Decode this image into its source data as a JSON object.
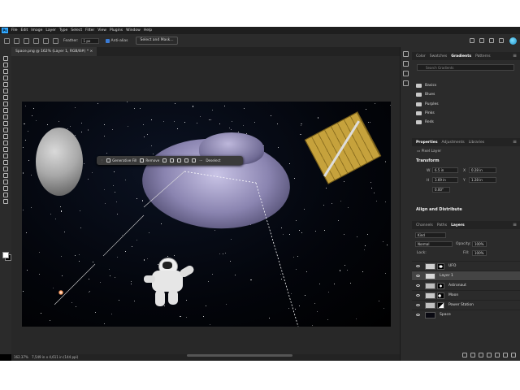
{
  "menubar": {
    "logo": "Ps",
    "items": [
      "File",
      "Edit",
      "Image",
      "Layer",
      "Type",
      "Select",
      "Filter",
      "View",
      "Plugins",
      "Window",
      "Help"
    ]
  },
  "options": {
    "feather_label": "Feather:",
    "feather_value": "1 px",
    "antialias_label": "Anti-alias",
    "select_mask": "Select and Mask..."
  },
  "document": {
    "tab": "Space.png @ 162% (Layer 1, RGB/8#) *"
  },
  "context_bar": {
    "generative_fill": "Generative Fill",
    "remove": "Remove",
    "deselect": "Deselect"
  },
  "status": {
    "zoom": "162.37%",
    "size": "7,549 in x 4,611 in (144 ppi)"
  },
  "gradients_panel": {
    "tabs": [
      "Color",
      "Swatches",
      "Gradients",
      "Patterns"
    ],
    "active": "Gradients",
    "search_placeholder": "Search Gradients",
    "folders": [
      "Basics",
      "Blues",
      "Purples",
      "Pinks",
      "Reds"
    ]
  },
  "properties_panel": {
    "tabs": [
      "Properties",
      "Adjustments",
      "Libraries"
    ],
    "layer_type": "Pixel Layer",
    "transform_title": "Transform",
    "w_label": "W",
    "w_value": "6.5 in",
    "x_label": "X",
    "x_value": "0.28 in",
    "h_label": "H",
    "h_value": "3.69 in",
    "y_label": "Y",
    "y_value": "1.28 in",
    "angle_value": "0.00°",
    "align_title": "Align and Distribute"
  },
  "layers_panel": {
    "tabs": [
      "Channels",
      "Paths",
      "Layers"
    ],
    "kind": "Kind",
    "blend_mode": "Normal",
    "opacity_label": "Opacity:",
    "opacity_value": "100%",
    "lock_label": "Lock:",
    "fill_label": "Fill:",
    "fill_value": "100%",
    "layers": [
      {
        "name": "UFO"
      },
      {
        "name": "Layer 1"
      },
      {
        "name": "Astronaut"
      },
      {
        "name": "Moon"
      },
      {
        "name": "Power Station"
      },
      {
        "name": "Space"
      }
    ]
  },
  "colors": {
    "accent": "#31a8ff",
    "panel_bg": "#2b2b2b",
    "selected_row": "#444444"
  }
}
